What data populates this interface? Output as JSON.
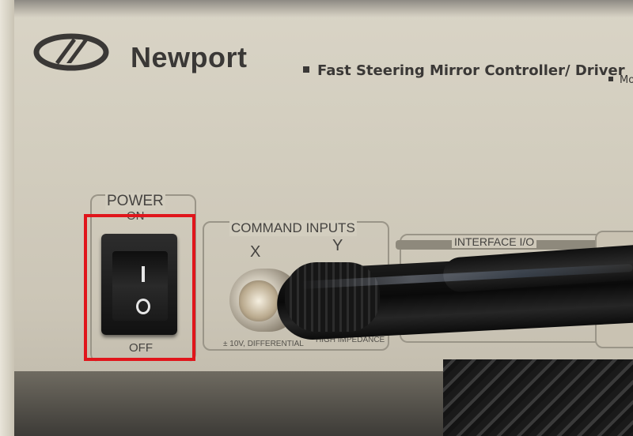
{
  "header": {
    "brand": "Newport",
    "subtitle": "Fast Steering Mirror Controller/ Driver",
    "model_fragment": "Mo"
  },
  "power": {
    "title": "POWER",
    "on_label": "ON",
    "off_label": "OFF",
    "rocker_top_symbol": "I",
    "rocker_bottom_symbol": "O"
  },
  "command_inputs": {
    "title": "COMMAND INPUTS",
    "axis_x": "X",
    "axis_y": "Y",
    "spec_left": "± 10V, DIFFERENTIAL",
    "spec_right": "HIGH IMPEDANCE"
  },
  "interface": {
    "title": "INTERFACE I/O"
  },
  "colors": {
    "panel": "#d3cebf",
    "text": "#3a3836",
    "highlight": "#e0151b"
  }
}
